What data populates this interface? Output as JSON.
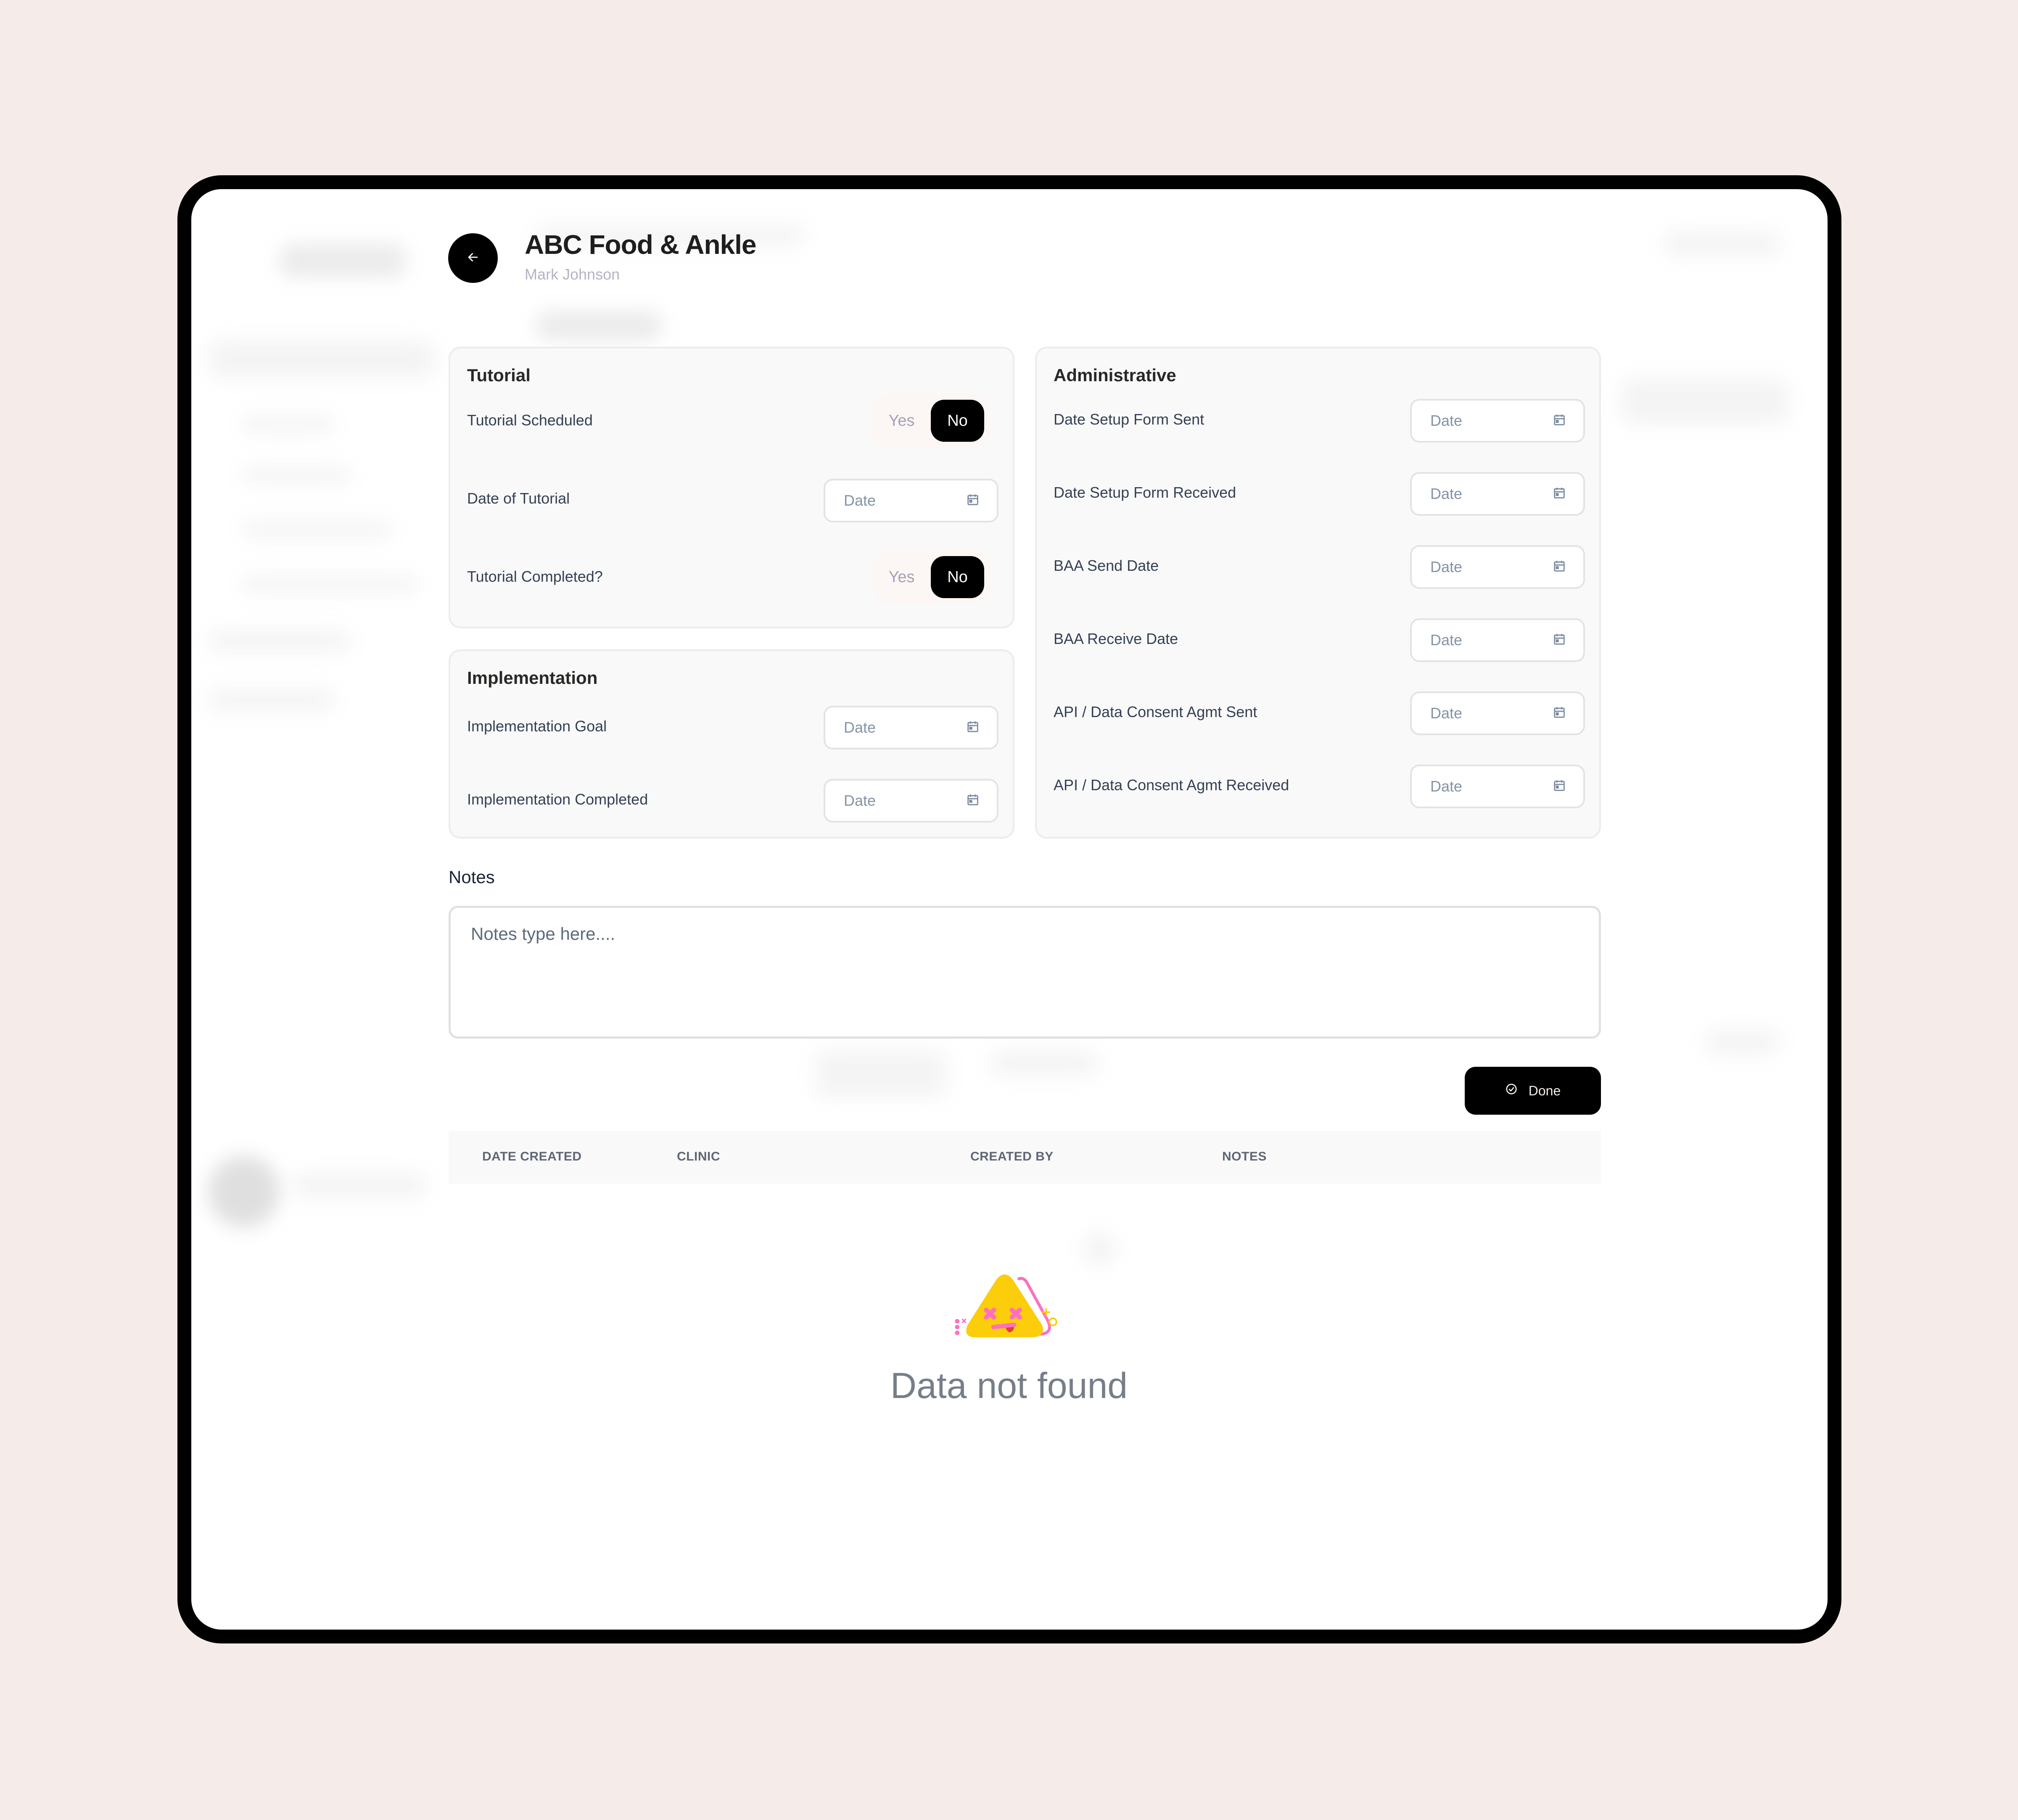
{
  "header": {
    "title": "ABC Food & Ankle",
    "subtitle": "Mark Johnson",
    "back_icon": "arrow-left-icon"
  },
  "tutorial": {
    "title": "Tutorial",
    "rows": [
      {
        "label": "Tutorial Scheduled",
        "type": "toggle",
        "options": [
          "Yes",
          "No"
        ],
        "selected": "No"
      },
      {
        "label": "Date of Tutorial",
        "type": "date",
        "placeholder": "Date"
      },
      {
        "label": "Tutorial Completed?",
        "type": "toggle",
        "options": [
          "Yes",
          "No"
        ],
        "selected": "No"
      }
    ]
  },
  "implementation": {
    "title": "Implementation",
    "rows": [
      {
        "label": "Implementation Goal",
        "type": "date",
        "placeholder": "Date"
      },
      {
        "label": "Implementation Completed",
        "type": "date",
        "placeholder": "Date"
      }
    ]
  },
  "administrative": {
    "title": "Administrative",
    "rows": [
      {
        "label": "Date Setup Form Sent",
        "type": "date",
        "placeholder": "Date"
      },
      {
        "label": "Date Setup Form Received",
        "type": "date",
        "placeholder": "Date"
      },
      {
        "label": "BAA Send Date",
        "type": "date",
        "placeholder": "Date"
      },
      {
        "label": "BAA Receive Date",
        "type": "date",
        "placeholder": "Date"
      },
      {
        "label": "API / Data Consent Agmt Sent",
        "type": "date",
        "placeholder": "Date"
      },
      {
        "label": "API / Data Consent Agmt Received",
        "type": "date",
        "placeholder": "Date"
      }
    ]
  },
  "notes": {
    "label": "Notes",
    "value": "",
    "placeholder": "Notes type here...."
  },
  "actions": {
    "done_label": "Done",
    "done_icon": "check-circle-icon"
  },
  "table": {
    "columns": [
      "DATE CREATED",
      "CLINIC",
      "CREATED BY",
      "NOTES"
    ],
    "rows": []
  },
  "empty_state": {
    "text": "Data not found",
    "illustration": "dizzy-triangle-face"
  },
  "colors": {
    "page_background": "#f5ecea",
    "frame": "#000000",
    "primary_button": "#000000",
    "illustration_yellow": "#fbcd0b",
    "illustration_pink": "#ff6fbf"
  }
}
